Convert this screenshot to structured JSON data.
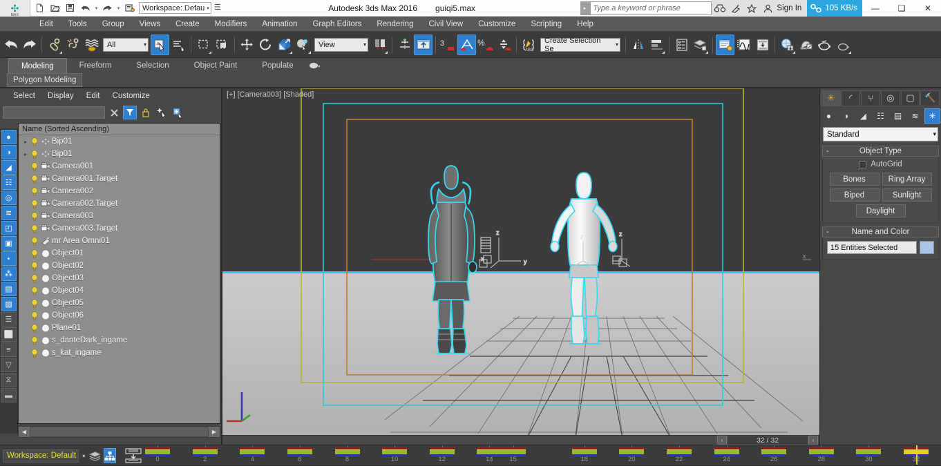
{
  "titlebar": {
    "logo_icon": "max-logo-icon",
    "logo_caption": "MAX",
    "quick_access": [
      {
        "name": "new-file-button",
        "icon": "new-file-icon",
        "glyph": "⬜"
      },
      {
        "name": "open-file-button",
        "icon": "open-folder-icon",
        "glyph": "📂"
      },
      {
        "name": "save-file-button",
        "icon": "save-disk-icon",
        "glyph": "💾"
      },
      {
        "name": "undo-button",
        "icon": "undo-arrow-icon",
        "glyph": "↶"
      },
      {
        "name": "redo-button",
        "icon": "redo-arrow-icon",
        "glyph": "↷"
      },
      {
        "name": "project-folder-button",
        "icon": "project-folder-icon",
        "glyph": "🗂"
      }
    ],
    "workspace_selector": "Workspace: Defau",
    "app_name": "Autodesk 3ds Max 2016",
    "file_name": "guiqi5.max",
    "search_placeholder": "Type a keyword or phrase",
    "search_value": "",
    "right_icons": [
      {
        "name": "binoculars-icon",
        "glyph": "🔭"
      },
      {
        "name": "satellite-dish-icon",
        "glyph": "📡"
      },
      {
        "name": "favorites-star-icon",
        "glyph": "☆"
      },
      {
        "name": "user-account-icon",
        "glyph": "👤"
      }
    ],
    "sign_in_label": "Sign In",
    "network_icon": "network-activity-icon",
    "network_speed": "105 KB/s",
    "network_color": "#2ca7e0",
    "window_controls": [
      {
        "name": "minimize-button",
        "glyph": "—"
      },
      {
        "name": "maximize-button",
        "glyph": "❐"
      },
      {
        "name": "close-button",
        "glyph": "✕"
      }
    ]
  },
  "menubar": {
    "items": [
      {
        "label": "Edit"
      },
      {
        "label": "Tools"
      },
      {
        "label": "Group"
      },
      {
        "label": "Views"
      },
      {
        "label": "Create"
      },
      {
        "label": "Modifiers"
      },
      {
        "label": "Animation"
      },
      {
        "label": "Graph Editors"
      },
      {
        "label": "Rendering"
      },
      {
        "label": "Civil View"
      },
      {
        "label": "Customize"
      },
      {
        "label": "Scripting"
      },
      {
        "label": "Help"
      }
    ]
  },
  "main_toolbar": {
    "selection_filter": "All",
    "reference_coord_system": "View",
    "named_selection_set": "Create Selection Se",
    "snap_percent_label": "%",
    "snap_angle_label": "3",
    "buttons": [
      {
        "name": "undo-button",
        "icon": "undo-arrow-icon"
      },
      {
        "name": "redo-button",
        "icon": "redo-arrow-icon"
      },
      {
        "name": "select-and-link-button",
        "icon": "link-chain-icon"
      },
      {
        "name": "unlink-selection-button",
        "icon": "unlink-chain-icon"
      },
      {
        "name": "bind-to-space-warp-button",
        "icon": "space-warp-icon"
      },
      {
        "name": "select-object-button",
        "icon": "select-cursor-icon",
        "active": true
      },
      {
        "name": "select-by-name-button",
        "icon": "select-by-name-icon"
      },
      {
        "name": "rectangular-selection-region-button",
        "icon": "rect-region-icon"
      },
      {
        "name": "window-crossing-toggle-button",
        "icon": "window-crossing-icon"
      },
      {
        "name": "select-and-move-button",
        "icon": "move-arrows-icon"
      },
      {
        "name": "select-and-rotate-button",
        "icon": "rotate-circle-icon"
      },
      {
        "name": "select-and-scale-button",
        "icon": "scale-square-icon"
      },
      {
        "name": "use-center-flyout-button",
        "icon": "pivot-center-icon"
      },
      {
        "name": "mirror-button",
        "icon": "mirror-icon"
      },
      {
        "name": "align-button",
        "icon": "align-icon"
      },
      {
        "name": "layer-manager-button",
        "icon": "layer-list-icon"
      },
      {
        "name": "scene-explorer-button",
        "icon": "scene-explorer-icon"
      },
      {
        "name": "material-editor-button",
        "icon": "material-editor-icon",
        "active": true
      },
      {
        "name": "curve-editor-button",
        "icon": "curve-editor-icon"
      },
      {
        "name": "schematic-view-button",
        "icon": "schematic-view-icon"
      },
      {
        "name": "render-setup-button",
        "icon": "render-setup-icon"
      },
      {
        "name": "rendered-frame-window-button",
        "icon": "rendered-frame-icon"
      },
      {
        "name": "render-production-button",
        "icon": "teapot-render-icon"
      },
      {
        "name": "render-iterative-button",
        "icon": "teapot-iterative-icon"
      }
    ]
  },
  "ribbon": {
    "tabs": [
      {
        "label": "Modeling",
        "active": true
      },
      {
        "label": "Freeform",
        "active": false
      },
      {
        "label": "Selection",
        "active": false
      },
      {
        "label": "Object Paint",
        "active": false
      },
      {
        "label": "Populate",
        "active": false
      }
    ],
    "panels": [
      {
        "label": "Polygon Modeling"
      }
    ],
    "populate_icon": "populate-people-icon"
  },
  "left_strip": {
    "items": [
      {
        "name": "filter-geometry-icon",
        "glyph": "●",
        "on": true
      },
      {
        "name": "filter-shapes-icon",
        "glyph": "◑",
        "on": true
      },
      {
        "name": "filter-lights-icon",
        "glyph": "◢",
        "on": true
      },
      {
        "name": "filter-cameras-icon",
        "glyph": "☷",
        "on": true
      },
      {
        "name": "filter-helpers-icon",
        "glyph": "◎",
        "on": true
      },
      {
        "name": "filter-space-warps-icon",
        "glyph": "≋",
        "on": true
      },
      {
        "name": "filter-groups-icon",
        "glyph": "◰",
        "on": true
      },
      {
        "name": "filter-xrefs-icon",
        "glyph": "▣",
        "on": true
      },
      {
        "name": "filter-bones-icon",
        "glyph": "⋆",
        "on": true
      },
      {
        "name": "filter-particles-icon",
        "glyph": "⁂",
        "on": true
      },
      {
        "name": "filter-layers-icon",
        "glyph": "▤",
        "on": true
      },
      {
        "name": "filter-materials-icon",
        "glyph": "▨",
        "on": true
      },
      {
        "name": "list-view-icon",
        "glyph": "☰",
        "on": false
      },
      {
        "name": "blank-panel-icon",
        "glyph": "⬜",
        "on": false
      },
      {
        "name": "sort-list-icon",
        "glyph": "≡",
        "on": false
      },
      {
        "name": "filter-funnel-icon",
        "glyph": "▽",
        "on": false
      },
      {
        "name": "advanced-filter-icon",
        "glyph": "⧖",
        "on": false
      },
      {
        "name": "collapse-panel-icon",
        "glyph": "▬",
        "on": false
      }
    ]
  },
  "scene_explorer": {
    "menus": [
      {
        "label": "Select"
      },
      {
        "label": "Display"
      },
      {
        "label": "Edit"
      },
      {
        "label": "Customize"
      }
    ],
    "search_value": "",
    "tools": [
      {
        "name": "clear-search-button",
        "icon": "close-x-icon",
        "glyph": "✕",
        "on": false
      },
      {
        "name": "filter-toggle-button",
        "icon": "funnel-filter-icon",
        "glyph": "▼",
        "on": true
      },
      {
        "name": "lock-selection-button",
        "icon": "lock-icon",
        "glyph": "🔒",
        "on": false
      },
      {
        "name": "add-object-button",
        "icon": "add-plus-cursor-icon",
        "glyph": "➕",
        "on": false
      },
      {
        "name": "expand-tree-button",
        "icon": "expand-tree-icon",
        "glyph": "▦",
        "on": false
      }
    ],
    "column_header": "Name (Sorted Ascending)",
    "rows": [
      {
        "label": "Bip01",
        "expandable": true,
        "type": "bone"
      },
      {
        "label": "Bip01",
        "expandable": true,
        "type": "bone"
      },
      {
        "label": "Camera001",
        "expandable": false,
        "type": "camera"
      },
      {
        "label": "Camera001.Target",
        "expandable": false,
        "type": "camera"
      },
      {
        "label": "Camera002",
        "expandable": false,
        "type": "camera"
      },
      {
        "label": "Camera002.Target",
        "expandable": false,
        "type": "camera"
      },
      {
        "label": "Camera003",
        "expandable": false,
        "type": "camera"
      },
      {
        "label": "Camera003.Target",
        "expandable": false,
        "type": "camera"
      },
      {
        "label": "mr Area Omni01",
        "expandable": false,
        "type": "light"
      },
      {
        "label": "Object01",
        "expandable": false,
        "type": "geometry"
      },
      {
        "label": "Object02",
        "expandable": false,
        "type": "geometry"
      },
      {
        "label": "Object03",
        "expandable": false,
        "type": "geometry"
      },
      {
        "label": "Object04",
        "expandable": false,
        "type": "geometry"
      },
      {
        "label": "Object05",
        "expandable": false,
        "type": "geometry"
      },
      {
        "label": "Object06",
        "expandable": false,
        "type": "geometry"
      },
      {
        "label": "Plane01",
        "expandable": false,
        "type": "geometry"
      },
      {
        "label": "s_danteDark_ingame",
        "expandable": false,
        "type": "geometry"
      },
      {
        "label": "s_kat_ingame",
        "expandable": false,
        "type": "geometry"
      }
    ],
    "hscroll_left": "◀",
    "hscroll_right": "▶"
  },
  "viewport": {
    "label": "[+] [Camera003] [Shaded]",
    "axis_labels": [
      "X",
      "Y",
      "Z"
    ],
    "safeframe_color": "#b9b335",
    "teal_color": "#2ecbd8",
    "orange_color": "#b8812c",
    "horizon_color": "#32c8e0"
  },
  "command_panel": {
    "tabs": [
      {
        "name": "create-tab",
        "icon": "create-star-icon",
        "glyph": "✳",
        "active": true
      },
      {
        "name": "modify-tab",
        "icon": "modify-curve-icon",
        "glyph": "◜",
        "active": false
      },
      {
        "name": "hierarchy-tab",
        "icon": "hierarchy-tree-icon",
        "glyph": "⑂",
        "active": false
      },
      {
        "name": "motion-tab",
        "icon": "motion-wheel-icon",
        "glyph": "◎",
        "active": false
      },
      {
        "name": "display-tab",
        "icon": "display-monitor-icon",
        "glyph": "▢",
        "active": false
      },
      {
        "name": "utilities-tab",
        "icon": "utilities-hammer-icon",
        "glyph": "🔨",
        "active": false
      }
    ],
    "categories": [
      {
        "name": "geometry-category",
        "icon": "sphere-icon",
        "glyph": "●",
        "on": false
      },
      {
        "name": "shapes-category",
        "icon": "shapes-icon",
        "glyph": "◑",
        "on": false
      },
      {
        "name": "lights-category",
        "icon": "light-icon",
        "glyph": "◢",
        "on": false
      },
      {
        "name": "cameras-category",
        "icon": "camera-icon",
        "glyph": "☷",
        "on": false
      },
      {
        "name": "helpers-category",
        "icon": "tape-helper-icon",
        "glyph": "▤",
        "on": false
      },
      {
        "name": "space-warps-category",
        "icon": "space-warp-icon",
        "glyph": "≋",
        "on": false
      },
      {
        "name": "systems-category",
        "icon": "systems-star-icon",
        "glyph": "✳",
        "on": true
      }
    ],
    "subtype": "Standard",
    "rollouts": [
      {
        "title": "Object Type",
        "minus": "-",
        "autogrid_label": "AutoGrid",
        "autogrid_checked": false,
        "buttons": [
          "Bones",
          "Ring Array",
          "Biped",
          "Sunlight",
          "Daylight"
        ]
      },
      {
        "title": "Name and Color",
        "minus": "-",
        "name_value": "15 Entities Selected",
        "color_swatch": "#a8c7e8"
      }
    ]
  },
  "time_slider": {
    "frame_display": "32 / 32",
    "prev_arrow": "‹",
    "next_arrow": "›"
  },
  "track_bar": {
    "workspace_label": "Workspace: Default",
    "workspace_dot": "▪",
    "icons": [
      {
        "name": "layer-stack-icon",
        "glyph": "≣",
        "on": false
      },
      {
        "name": "scene-hierarchy-icon",
        "glyph": "⑂",
        "on": true
      }
    ],
    "key_filter_icon": "key-filter-icon",
    "tick_labels": [
      "0",
      "2",
      "4",
      "6",
      "8",
      "10",
      "12",
      "14",
      "15",
      "18",
      "20",
      "22",
      "24",
      "26",
      "28",
      "30",
      "32"
    ],
    "keys": [
      0,
      2,
      4,
      6,
      8,
      10,
      12,
      14,
      15,
      18,
      20,
      22,
      24,
      26,
      28,
      30,
      32
    ],
    "current_frame": 32,
    "key_colors": {
      "top": "#8a2020",
      "mid": "#9aba28",
      "bottom": "#2b3a8a",
      "current": "#e8d020"
    }
  }
}
